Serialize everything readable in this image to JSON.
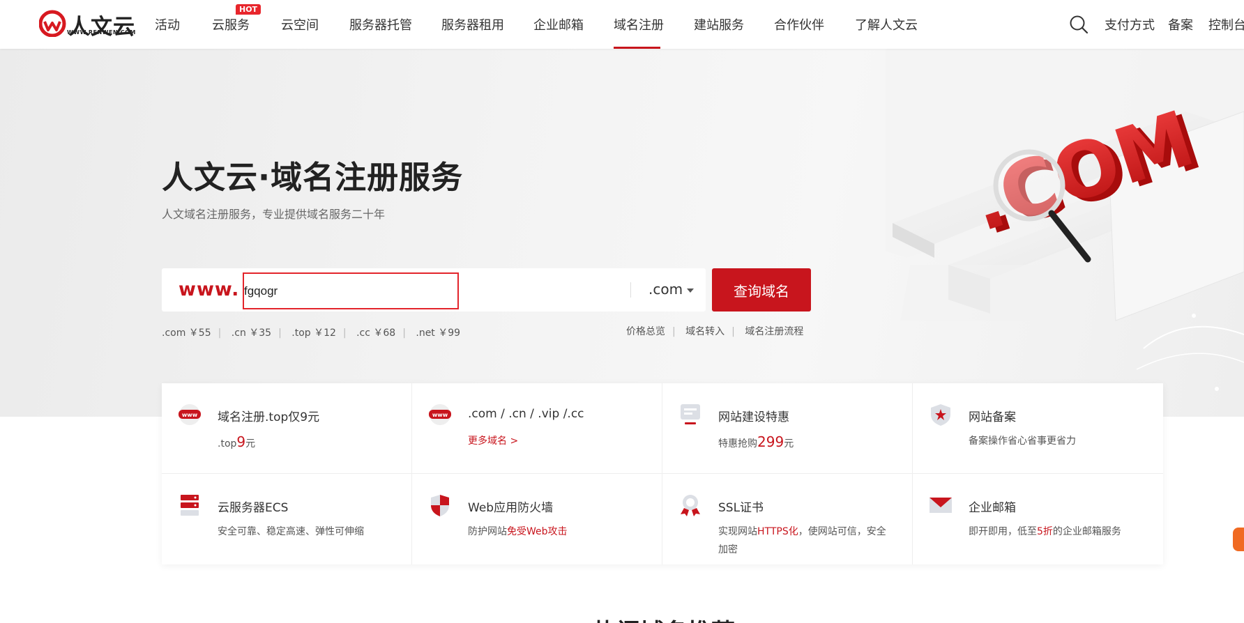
{
  "colors": {
    "accent": "#c8151d",
    "hot": "#e8262c"
  },
  "logo": {
    "text": "人文云",
    "subtext": "WWW.RENWEN.COM"
  },
  "nav": {
    "items": [
      {
        "label": "活动"
      },
      {
        "label": "云服务",
        "badge": "HOT"
      },
      {
        "label": "云空间"
      },
      {
        "label": "服务器托管"
      },
      {
        "label": "服务器租用"
      },
      {
        "label": "企业邮箱"
      },
      {
        "label": "域名注册",
        "active": true
      },
      {
        "label": "建站服务"
      },
      {
        "label": "合作伙伴"
      },
      {
        "label": "了解人文云"
      }
    ]
  },
  "header_right": {
    "search_icon": "search-icon",
    "payment": "支付方式",
    "filing": "备案",
    "console": "控制台"
  },
  "hero": {
    "title": "人文云·域名注册服务",
    "subtitle": "人文域名注册服务，专业提供域名服务二十年",
    "www_label": "www.",
    "domain_input_value": "fgqogr",
    "suffix_selected": ".com",
    "query_button": "查询域名",
    "prices": [
      {
        "text": ".com ￥55"
      },
      {
        "text": ".cn ￥35"
      },
      {
        "text": ".top ￥12"
      },
      {
        "text": ".cc ￥68"
      },
      {
        "text": ".net ￥99"
      }
    ],
    "quick_links": [
      "价格总览",
      "域名转入",
      "域名注册流程"
    ]
  },
  "cards": [
    {
      "icon": "www-icon",
      "title": "域名注册.top仅9元",
      "desc_prefix": ".top",
      "desc_highlight": "9",
      "desc_suffix": "元"
    },
    {
      "icon": "www-icon",
      "title": ".com / .cn / .vip /.cc",
      "link": "更多域名 >"
    },
    {
      "icon": "website-build-icon",
      "title": "网站建设特惠",
      "desc_prefix": "特惠抢购",
      "desc_highlight": "299",
      "desc_suffix": "元"
    },
    {
      "icon": "shield-star-icon",
      "title": "网站备案",
      "desc": "备案操作省心省事更省力"
    },
    {
      "icon": "server-icon",
      "title": "云服务器ECS",
      "desc": "安全可靠、稳定高速、弹性可伸缩"
    },
    {
      "icon": "firewall-shield-icon",
      "title": "Web应用防火墙",
      "desc_prefix": "防护网站",
      "desc_highlight": "免受Web攻击"
    },
    {
      "icon": "ssl-certificate-icon",
      "title": "SSL证书",
      "desc_prefix": "实现网站",
      "desc_highlight": "HTTPS化",
      "desc_suffix": "，使网站可信，安全",
      "desc_line2": "加密"
    },
    {
      "icon": "mail-icon",
      "title": "企业邮箱",
      "desc_prefix": "即开即用，低至",
      "desc_highlight": "5折",
      "desc_suffix": "的企业邮箱服务"
    }
  ],
  "bottom_section_title": "热门域名推荐"
}
